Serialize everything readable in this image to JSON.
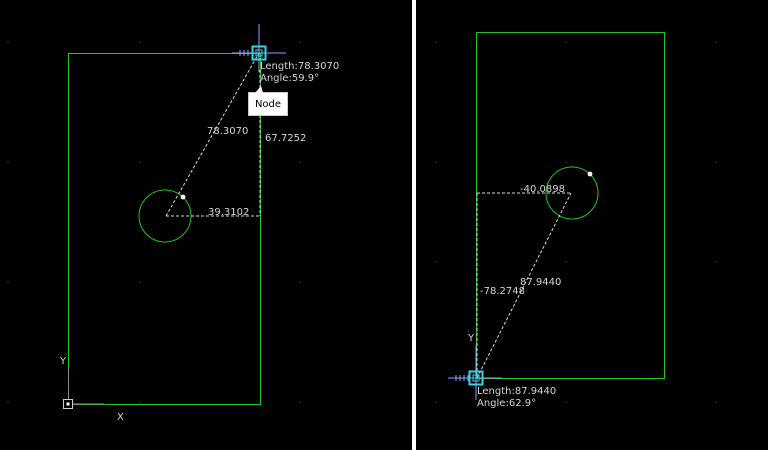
{
  "colors": {
    "background": "#000000",
    "outline": "#21c421",
    "dashed_guide": "#d8d8d8",
    "grid_dots": "#3a3a3a",
    "node_marker": "#2fd6e6",
    "divider": "#ffffff"
  },
  "left_view": {
    "cursor_readout": {
      "length": "Length:78.3070",
      "angle": "Angle:59.9°"
    },
    "tooltip": "Node",
    "dimensions": {
      "hypotenuse": "78.3070",
      "vertical": "67.7252",
      "horizontal": "39.3102"
    },
    "axis_labels": {
      "y": "Y",
      "x": "X"
    },
    "icons": [
      "crosshair-cursor-icon",
      "node-snap-icon",
      "origin-icon"
    ]
  },
  "right_view": {
    "cursor_readout": {
      "length": "Length:87.9440",
      "angle": "Angle:62.9°"
    },
    "dimensions": {
      "hypotenuse": "87.9440",
      "vertical": "-78.2748",
      "horizontal": "-40.0898"
    },
    "axis_labels": {
      "y": "Y"
    },
    "icons": [
      "crosshair-cursor-icon",
      "node-snap-icon"
    ]
  }
}
